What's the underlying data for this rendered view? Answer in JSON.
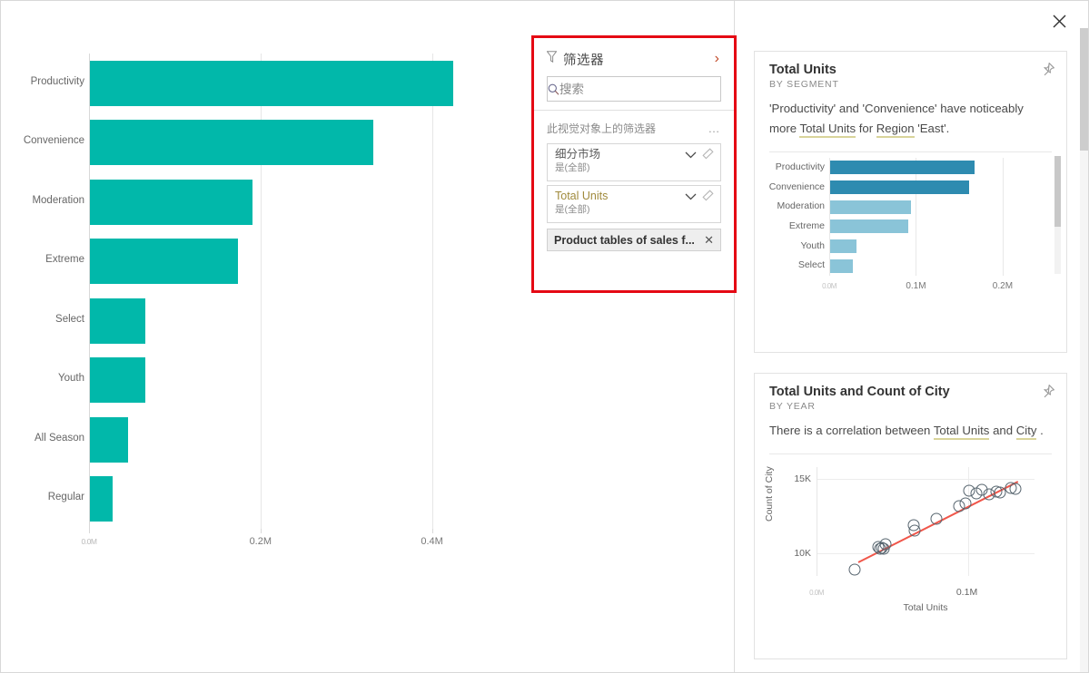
{
  "window": {
    "close_label": "✕"
  },
  "main_chart": {
    "x_ticks": [
      {
        "label": "0.0M",
        "value": 0
      },
      {
        "label": "0.2M",
        "value": 0.2
      },
      {
        "label": "0.4M",
        "value": 0.4
      }
    ],
    "bar_color": "#01b8aa"
  },
  "filter_pane": {
    "title": "筛选器",
    "title_icon": "funnel-icon",
    "expand_icon": "chevron-right-icon",
    "search_placeholder": "搜索",
    "search_value": "",
    "section_label": "此视觉对象上的筛选器",
    "section_more": "…",
    "filters": [
      {
        "name": "细分市场",
        "value": "是(全部)",
        "linked": false
      },
      {
        "name": "Total Units",
        "value": "是(全部)",
        "linked": true
      }
    ],
    "pill": {
      "label": "Product tables of sales f...",
      "close": "✕"
    },
    "highlight_color": "#e50914"
  },
  "insights": {
    "cards": [
      {
        "title": "Total Units",
        "subtitle": "BY SEGMENT",
        "desc_parts": [
          {
            "t": "'Productivity' and 'Convenience' have noticeably more ",
            "hl": false
          },
          {
            "t": "Total Units",
            "hl": true
          },
          {
            "t": " for ",
            "hl": false
          },
          {
            "t": "Region",
            "hl": true
          },
          {
            "t": " 'East'.",
            "hl": false
          }
        ],
        "pin_icon": "pin-icon"
      },
      {
        "title": "Total Units and Count of City",
        "subtitle": "BY YEAR",
        "desc_parts": [
          {
            "t": "There is a correlation between ",
            "hl": false
          },
          {
            "t": "Total Units",
            "hl": true
          },
          {
            "t": " and ",
            "hl": false
          },
          {
            "t": "City",
            "hl": true
          },
          {
            "t": " .",
            "hl": false
          }
        ],
        "pin_icon": "pin-icon"
      }
    ]
  },
  "chart_data": [
    {
      "type": "bar",
      "orientation": "horizontal",
      "title": "",
      "xlabel": "",
      "ylabel": "",
      "categories": [
        "Productivity",
        "Convenience",
        "Moderation",
        "Extreme",
        "Select",
        "Youth",
        "All Season",
        "Regular"
      ],
      "values": [
        0.424,
        0.331,
        0.19,
        0.173,
        0.065,
        0.065,
        0.044,
        0.026
      ],
      "value_unit": "M",
      "xlim": [
        0,
        0.5
      ],
      "xticks": [
        0,
        0.2,
        0.4
      ],
      "xticklabels": [
        "0.0M",
        "0.2M",
        "0.4M"
      ],
      "grid": true,
      "color": "#01b8aa",
      "legend": false
    },
    {
      "type": "bar",
      "orientation": "horizontal",
      "title": "Total Units",
      "subtitle": "BY SEGMENT",
      "xlabel": "",
      "ylabel": "",
      "categories": [
        "Productivity",
        "Convenience",
        "Moderation",
        "Extreme",
        "Youth",
        "Select"
      ],
      "values": [
        0.167,
        0.16,
        0.0935,
        0.0905,
        0.0305,
        0.0265
      ],
      "value_unit": "M",
      "xlim": [
        0,
        0.22
      ],
      "xticks": [
        0,
        0.1,
        0.2
      ],
      "xticklabels": [
        "0.0M",
        "0.1M",
        "0.2M"
      ],
      "grid": true,
      "colors": [
        "#2e8bb0",
        "#2e8bb0",
        "#8ac4d8",
        "#8ac4d8",
        "#8ac4d8",
        "#8ac4d8"
      ],
      "legend": false
    },
    {
      "type": "scatter",
      "title": "Total Units and Count of City",
      "subtitle": "BY YEAR",
      "xlabel": "Total Units",
      "ylabel": "Count of City",
      "xticks": [
        0,
        0.1
      ],
      "xticklabels": [
        "0.0M",
        "0.1M"
      ],
      "yticks": [
        10000,
        15000
      ],
      "yticklabels": [
        "10K",
        "15K"
      ],
      "xlim": [
        0,
        0.145
      ],
      "ylim": [
        8500,
        15800
      ],
      "grid": true,
      "trendline": {
        "color": "#f0564a",
        "x0": 0.027,
        "y0": 9500,
        "x1": 0.133,
        "y1": 14900
      },
      "points": [
        {
          "x": 0.0245,
          "y": 8950
        },
        {
          "x": 0.0405,
          "y": 10430
        },
        {
          "x": 0.0415,
          "y": 10300
        },
        {
          "x": 0.043,
          "y": 10380
        },
        {
          "x": 0.044,
          "y": 10300
        },
        {
          "x": 0.0455,
          "y": 10620
        },
        {
          "x": 0.064,
          "y": 11900
        },
        {
          "x": 0.0645,
          "y": 11570
        },
        {
          "x": 0.079,
          "y": 12340
        },
        {
          "x": 0.0945,
          "y": 13210
        },
        {
          "x": 0.0985,
          "y": 13380
        },
        {
          "x": 0.101,
          "y": 14200
        },
        {
          "x": 0.106,
          "y": 14060
        },
        {
          "x": 0.1095,
          "y": 14270
        },
        {
          "x": 0.114,
          "y": 13970
        },
        {
          "x": 0.119,
          "y": 14150
        },
        {
          "x": 0.1215,
          "y": 14080
        },
        {
          "x": 0.1285,
          "y": 14400
        },
        {
          "x": 0.132,
          "y": 14350
        }
      ]
    }
  ]
}
